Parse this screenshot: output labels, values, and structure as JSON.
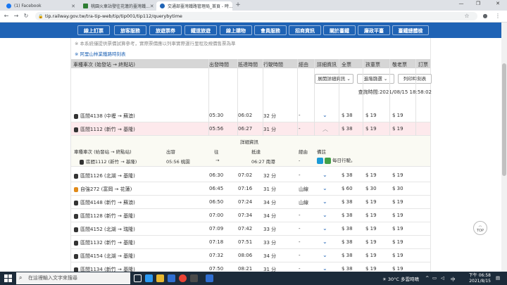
{
  "browser": {
    "tabs": [
      {
        "title": "(1) Facebook",
        "icon": "facebook-icon",
        "color": "#1877f2"
      },
      {
        "title": "桃園火車站發往花蓮的臺灣鐵...",
        "icon": "green-tab-icon",
        "color": "#2e7d32"
      },
      {
        "title": "交通部臺灣鐵路管理局_首頁 - 時...",
        "icon": "tra-logo-icon",
        "color": "#1f63b5"
      }
    ],
    "url": "tip.railway.gov.tw/tra-tip-web/tip/tip001/tip112/querybytime"
  },
  "nav": {
    "items": [
      "線上訂票",
      "旅客服務",
      "旅遊票券",
      "鐵道旅遊",
      "線上購物",
      "會員服務",
      "招商資訊",
      "關於臺鐵",
      "廉政平臺",
      "臺鐵總體檢"
    ]
  },
  "notes": {
    "line1": "※ 本系統僅提供票價試算參考，實際票價應以列車實際運行里程及規價售票為準",
    "link": "※ 阿里山林業鐵路時刻表"
  },
  "buttons": {
    "expand": "展開詳細資訊",
    "filter": "進階篩選",
    "print": "列印時刻表"
  },
  "query_time": "查詢時間:2021/08/15 18:58:02",
  "table": {
    "headers": [
      "車種車次 (始發站 → 終點站)",
      "出發時間",
      "抵達時間",
      "行駛時間",
      "經由",
      "詳細資訊",
      "全票",
      "孩童票",
      "敬老票",
      "訂票"
    ],
    "rows": [
      {
        "name": "區間4138 (中壢 → 蘇澳)",
        "dep": "05:30",
        "arr": "06:02",
        "dur": "32 分",
        "via": "-",
        "full": "$ 38",
        "child": "$ 19",
        "senior": "$ 19",
        "type": "dark"
      },
      {
        "name": "區間1112 (新竹 → 基隆)",
        "dep": "05:56",
        "arr": "06:27",
        "dur": "31 分",
        "via": "-",
        "full": "$ 38",
        "child": "$ 19",
        "senior": "$ 19",
        "type": "dark",
        "selected": true
      },
      {
        "name": "區間1126 (北湖 → 基隆)",
        "dep": "06:30",
        "arr": "07:02",
        "dur": "32 分",
        "via": "-",
        "full": "$ 38",
        "child": "$ 19",
        "senior": "$ 19",
        "type": "dark"
      },
      {
        "name": "自強272 (富岡 → 花蓮)",
        "dep": "06:45",
        "arr": "07:16",
        "dur": "31 分",
        "via": "山線",
        "full": "$ 60",
        "child": "$ 30",
        "senior": "$ 30",
        "type": "orange"
      },
      {
        "name": "區間4148 (新竹 → 蘇澳)",
        "dep": "06:50",
        "arr": "07:24",
        "dur": "34 分",
        "via": "山線",
        "full": "$ 38",
        "child": "$ 19",
        "senior": "$ 19",
        "type": "dark"
      },
      {
        "name": "區間1128 (新竹 → 基隆)",
        "dep": "07:00",
        "arr": "07:34",
        "dur": "34 分",
        "via": "-",
        "full": "$ 38",
        "child": "$ 19",
        "senior": "$ 19",
        "type": "dark"
      },
      {
        "name": "區間4152 (北湖 → 瑞隆)",
        "dep": "07:09",
        "arr": "07:42",
        "dur": "33 分",
        "via": "-",
        "full": "$ 38",
        "child": "$ 19",
        "senior": "$ 19",
        "type": "dark"
      },
      {
        "name": "區間1132 (新竹 → 基隆)",
        "dep": "07:18",
        "arr": "07:51",
        "dur": "33 分",
        "via": "-",
        "full": "$ 38",
        "child": "$ 19",
        "senior": "$ 19",
        "type": "dark"
      },
      {
        "name": "區間4154 (北湖 → 基隆)",
        "dep": "07:32",
        "arr": "08:06",
        "dur": "34 分",
        "via": "-",
        "full": "$ 38",
        "child": "$ 19",
        "senior": "$ 19",
        "type": "dark"
      },
      {
        "name": "區間1134 (新竹 → 基隆)",
        "dep": "07:50",
        "arr": "08:21",
        "dur": "31 分",
        "via": "-",
        "full": "$ 38",
        "child": "$ 19",
        "senior": "$ 19",
        "type": "dark"
      }
    ],
    "detail": {
      "title": "詳細資訊",
      "headers": [
        "車種車次 (始發站 → 終點站)",
        "出發",
        "往",
        "抵達",
        "經由",
        "備註"
      ],
      "train": "區間1112 (新竹 → 基隆)",
      "dep": "05:56 桃園",
      "arrow": "→",
      "arr": "06:27 南港",
      "via": "-",
      "note": "每日行駛。"
    }
  },
  "top_button": "TOP",
  "taskbar": {
    "search_placeholder": "在這裡輸入文字來搜尋",
    "weather": "30°C 多雲時晴",
    "lang": "中",
    "time": "下午 06:58",
    "date": "2021/8/15"
  }
}
